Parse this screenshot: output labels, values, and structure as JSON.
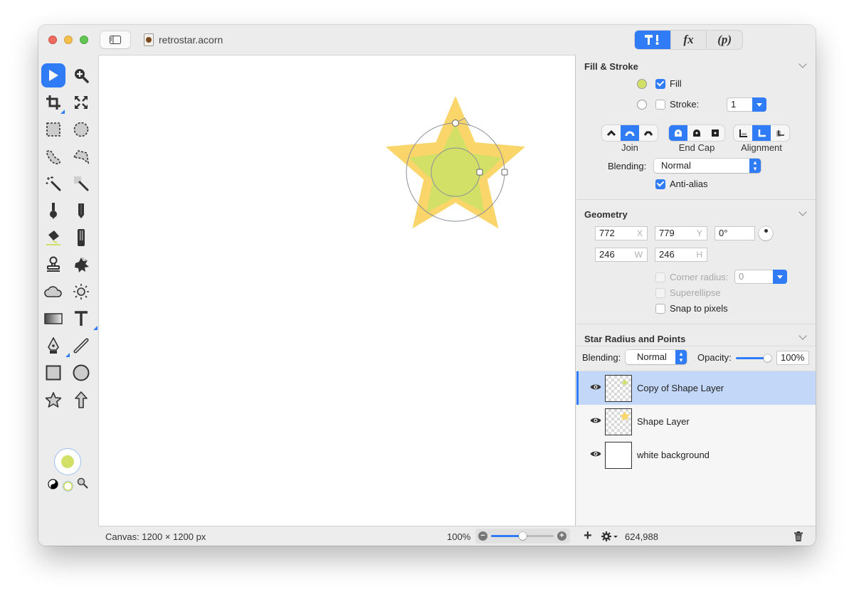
{
  "window": {
    "title": "retrostar.acorn",
    "file_icon": "acorn-document-icon"
  },
  "inspector_tabs": [
    {
      "label": "tools-icon",
      "icon": "hammer-and-brush-icon",
      "active": true
    },
    {
      "label": "fx",
      "active": false
    },
    {
      "label": "(p)",
      "active": false
    }
  ],
  "tools": [
    {
      "name": "select-tool",
      "active": true
    },
    {
      "name": "zoom-tool"
    },
    {
      "name": "crop-tool"
    },
    {
      "name": "transform-tool"
    },
    {
      "name": "rect-marquee-tool"
    },
    {
      "name": "ellipse-marquee-tool"
    },
    {
      "name": "lasso-tool"
    },
    {
      "name": "polygon-lasso-tool"
    },
    {
      "name": "magic-wand-tool"
    },
    {
      "name": "instant-alpha-tool"
    },
    {
      "name": "brush-tool"
    },
    {
      "name": "pencil-tool"
    },
    {
      "name": "paint-bucket-tool"
    },
    {
      "name": "eraser-tool"
    },
    {
      "name": "clone-stamp-tool"
    },
    {
      "name": "smudge-tool"
    },
    {
      "name": "cloud-tool"
    },
    {
      "name": "sun-tool"
    },
    {
      "name": "gradient-tool"
    },
    {
      "name": "text-tool"
    },
    {
      "name": "pen-tool"
    },
    {
      "name": "line-tool"
    },
    {
      "name": "rectangle-tool"
    },
    {
      "name": "oval-tool"
    },
    {
      "name": "star-tool"
    },
    {
      "name": "arrow-tool"
    }
  ],
  "colors": {
    "fill": "#d2e068",
    "accent": "#2f7cf6",
    "star_outer": "#f9d56a",
    "star_inner": "#d2e068"
  },
  "fill_stroke": {
    "title": "Fill & Stroke",
    "fill_label": "Fill",
    "fill_checked": true,
    "stroke_label": "Stroke:",
    "stroke_checked": false,
    "stroke_width": "1",
    "join_label": "Join",
    "endcap_label": "End Cap",
    "alignment_label": "Alignment",
    "join_selected": "round",
    "endcap_selected": "round",
    "alignment_selected": "center",
    "blending_label": "Blending:",
    "blending_value": "Normal",
    "antialias_label": "Anti-alias",
    "antialias_checked": true
  },
  "geometry": {
    "title": "Geometry",
    "x": "772",
    "x_unit": "X",
    "y": "779",
    "y_unit": "Y",
    "rotation": "0°",
    "w": "246",
    "w_unit": "W",
    "h": "246",
    "h_unit": "H",
    "corner_radius_label": "Corner radius:",
    "corner_radius_value": "0",
    "superellipse_label": "Superellipse",
    "snap_label": "Snap to pixels"
  },
  "star_section": {
    "title": "Star Radius and Points"
  },
  "layer_props": {
    "blending_label": "Blending:",
    "blending_value": "Normal",
    "opacity_label": "Opacity:",
    "opacity_value": "100%",
    "opacity_fraction": 1.0
  },
  "layers": [
    {
      "name": "Copy of Shape Layer",
      "selected": true,
      "visible": true,
      "thumb": "green-star"
    },
    {
      "name": "Shape Layer",
      "selected": false,
      "visible": true,
      "thumb": "yellow-star"
    },
    {
      "name": "white background",
      "selected": false,
      "visible": true,
      "thumb": "white"
    }
  ],
  "status": {
    "canvas_info": "Canvas: 1200 × 1200 px",
    "zoom": "100%",
    "zoom_fraction": 0.5,
    "zoom_minus": "−",
    "zoom_plus": "+"
  },
  "inspector_bottom": {
    "add_label": "+",
    "count": "624,988"
  }
}
